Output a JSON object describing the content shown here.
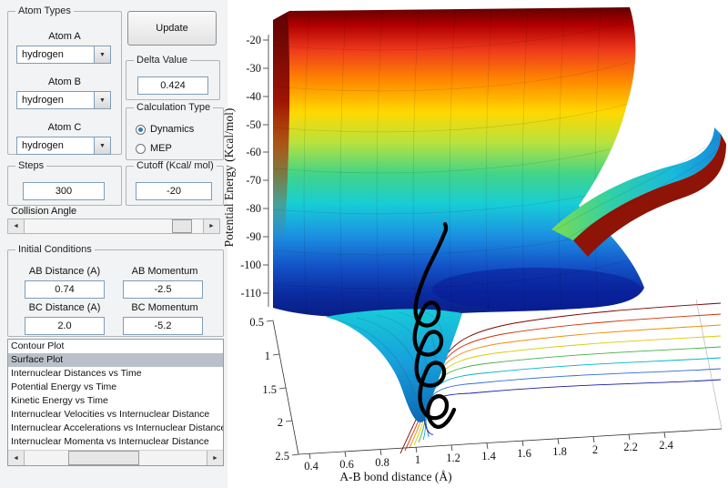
{
  "icons": {
    "dropdown_arrow": "▼",
    "arrow_left": "◄",
    "arrow_right": "►"
  },
  "panel": {
    "atom_types": {
      "legend": "Atom Types",
      "atom_a_label": "Atom A",
      "atom_a_value": "hydrogen",
      "atom_b_label": "Atom B",
      "atom_b_value": "hydrogen",
      "atom_c_label": "Atom C",
      "atom_c_value": "hydrogen"
    },
    "update_button_label": "Update",
    "delta": {
      "legend": "Delta Value",
      "value": "0.424"
    },
    "calc_type": {
      "legend": "Calculation Type",
      "dynamics_label": "Dynamics",
      "mep_label": "MEP",
      "selected": "Dynamics"
    },
    "steps": {
      "legend": "Steps",
      "value": "300"
    },
    "cutoff": {
      "legend": "Cutoff (Kcal/ mol)",
      "value": "-20"
    },
    "collision_angle_label": "Collision Angle",
    "initial_conditions": {
      "legend": "Initial Conditions",
      "ab_distance_label": "AB Distance (A)",
      "ab_distance_value": "0.74",
      "ab_momentum_label": "AB Momentum",
      "ab_momentum_value": "-2.5",
      "bc_distance_label": "BC Distance (A)",
      "bc_distance_value": "2.0",
      "bc_momentum_label": "BC Momentum",
      "bc_momentum_value": "-5.2"
    },
    "plot_list": {
      "items": [
        "Contour Plot",
        "Surface Plot",
        "Internuclear Distances vs Time",
        "Potential Energy vs Time",
        "Kinetic Energy vs Time",
        "Internuclear Velocities vs Internuclear Distance",
        "Internuclear Accelerations vs Internuclear Distance",
        "Internuclear Momenta vs Internuclear Distance"
      ],
      "selected_item": "Surface Plot",
      "selected_index": 1
    }
  },
  "plot": {
    "ylabel": "Potential Energy (Kcal/mol)",
    "xlabel": "A-B bond distance (Å)",
    "y_ticks": [
      "-20",
      "-30",
      "-40",
      "-50",
      "-60",
      "-70",
      "-80",
      "-90",
      "-100",
      "-110"
    ],
    "x_ticks": [
      "0.4",
      "0.6",
      "0.8",
      "1",
      "1.2",
      "1.4",
      "1.6",
      "1.8",
      "2",
      "2.2",
      "2.4"
    ],
    "depth_ticks": [
      "0.5",
      "1",
      "1.5",
      "2",
      "2.5"
    ]
  },
  "chart_data": {
    "type": "heatmap",
    "subtype": "3d-potential-energy-surface with contour projection and black trajectory",
    "xlabel": "A-B bond distance (Å)",
    "zlabel": "Potential Energy (Kcal/mol)",
    "x_ticks": [
      0.4,
      0.6,
      0.8,
      1,
      1.2,
      1.4,
      1.6,
      1.8,
      2,
      2.2,
      2.4
    ],
    "depth_ticks": [
      0.5,
      1,
      1.5,
      2,
      2.5
    ],
    "energy_ticks": [
      -20,
      -30,
      -40,
      -50,
      -60,
      -70,
      -80,
      -90,
      -100,
      -110
    ],
    "energy_range": [
      -110,
      -20
    ],
    "colormap": "jet",
    "grid": false,
    "legend_position": "none"
  }
}
